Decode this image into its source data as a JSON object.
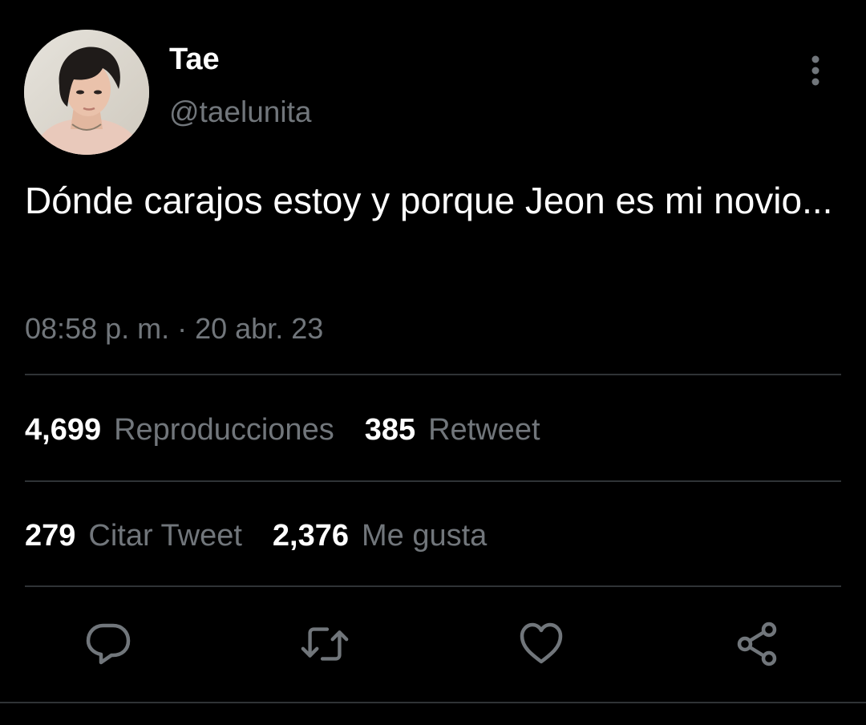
{
  "user": {
    "display_name": "Tae",
    "handle": "@taelunita"
  },
  "tweet": {
    "text": "Dónde carajos estoy y porque Jeon es mi novio...",
    "timestamp": "08:58 p. m. · 20 abr. 23"
  },
  "stats": {
    "views": {
      "count": "4,699",
      "label": "Reproducciones"
    },
    "retweets": {
      "count": "385",
      "label": "Retweet"
    },
    "quotes": {
      "count": "279",
      "label": "Citar Tweet"
    },
    "likes": {
      "count": "2,376",
      "label": "Me gusta"
    }
  },
  "icons": {
    "more": "more-vertical-icon",
    "reply": "reply-bubble-icon",
    "retweet": "retweet-icon",
    "like": "heart-icon",
    "share": "share-icon"
  },
  "colors": {
    "background": "#000000",
    "primary_text": "#ffffff",
    "secondary_text": "#71767b",
    "divider": "#2f3336"
  }
}
